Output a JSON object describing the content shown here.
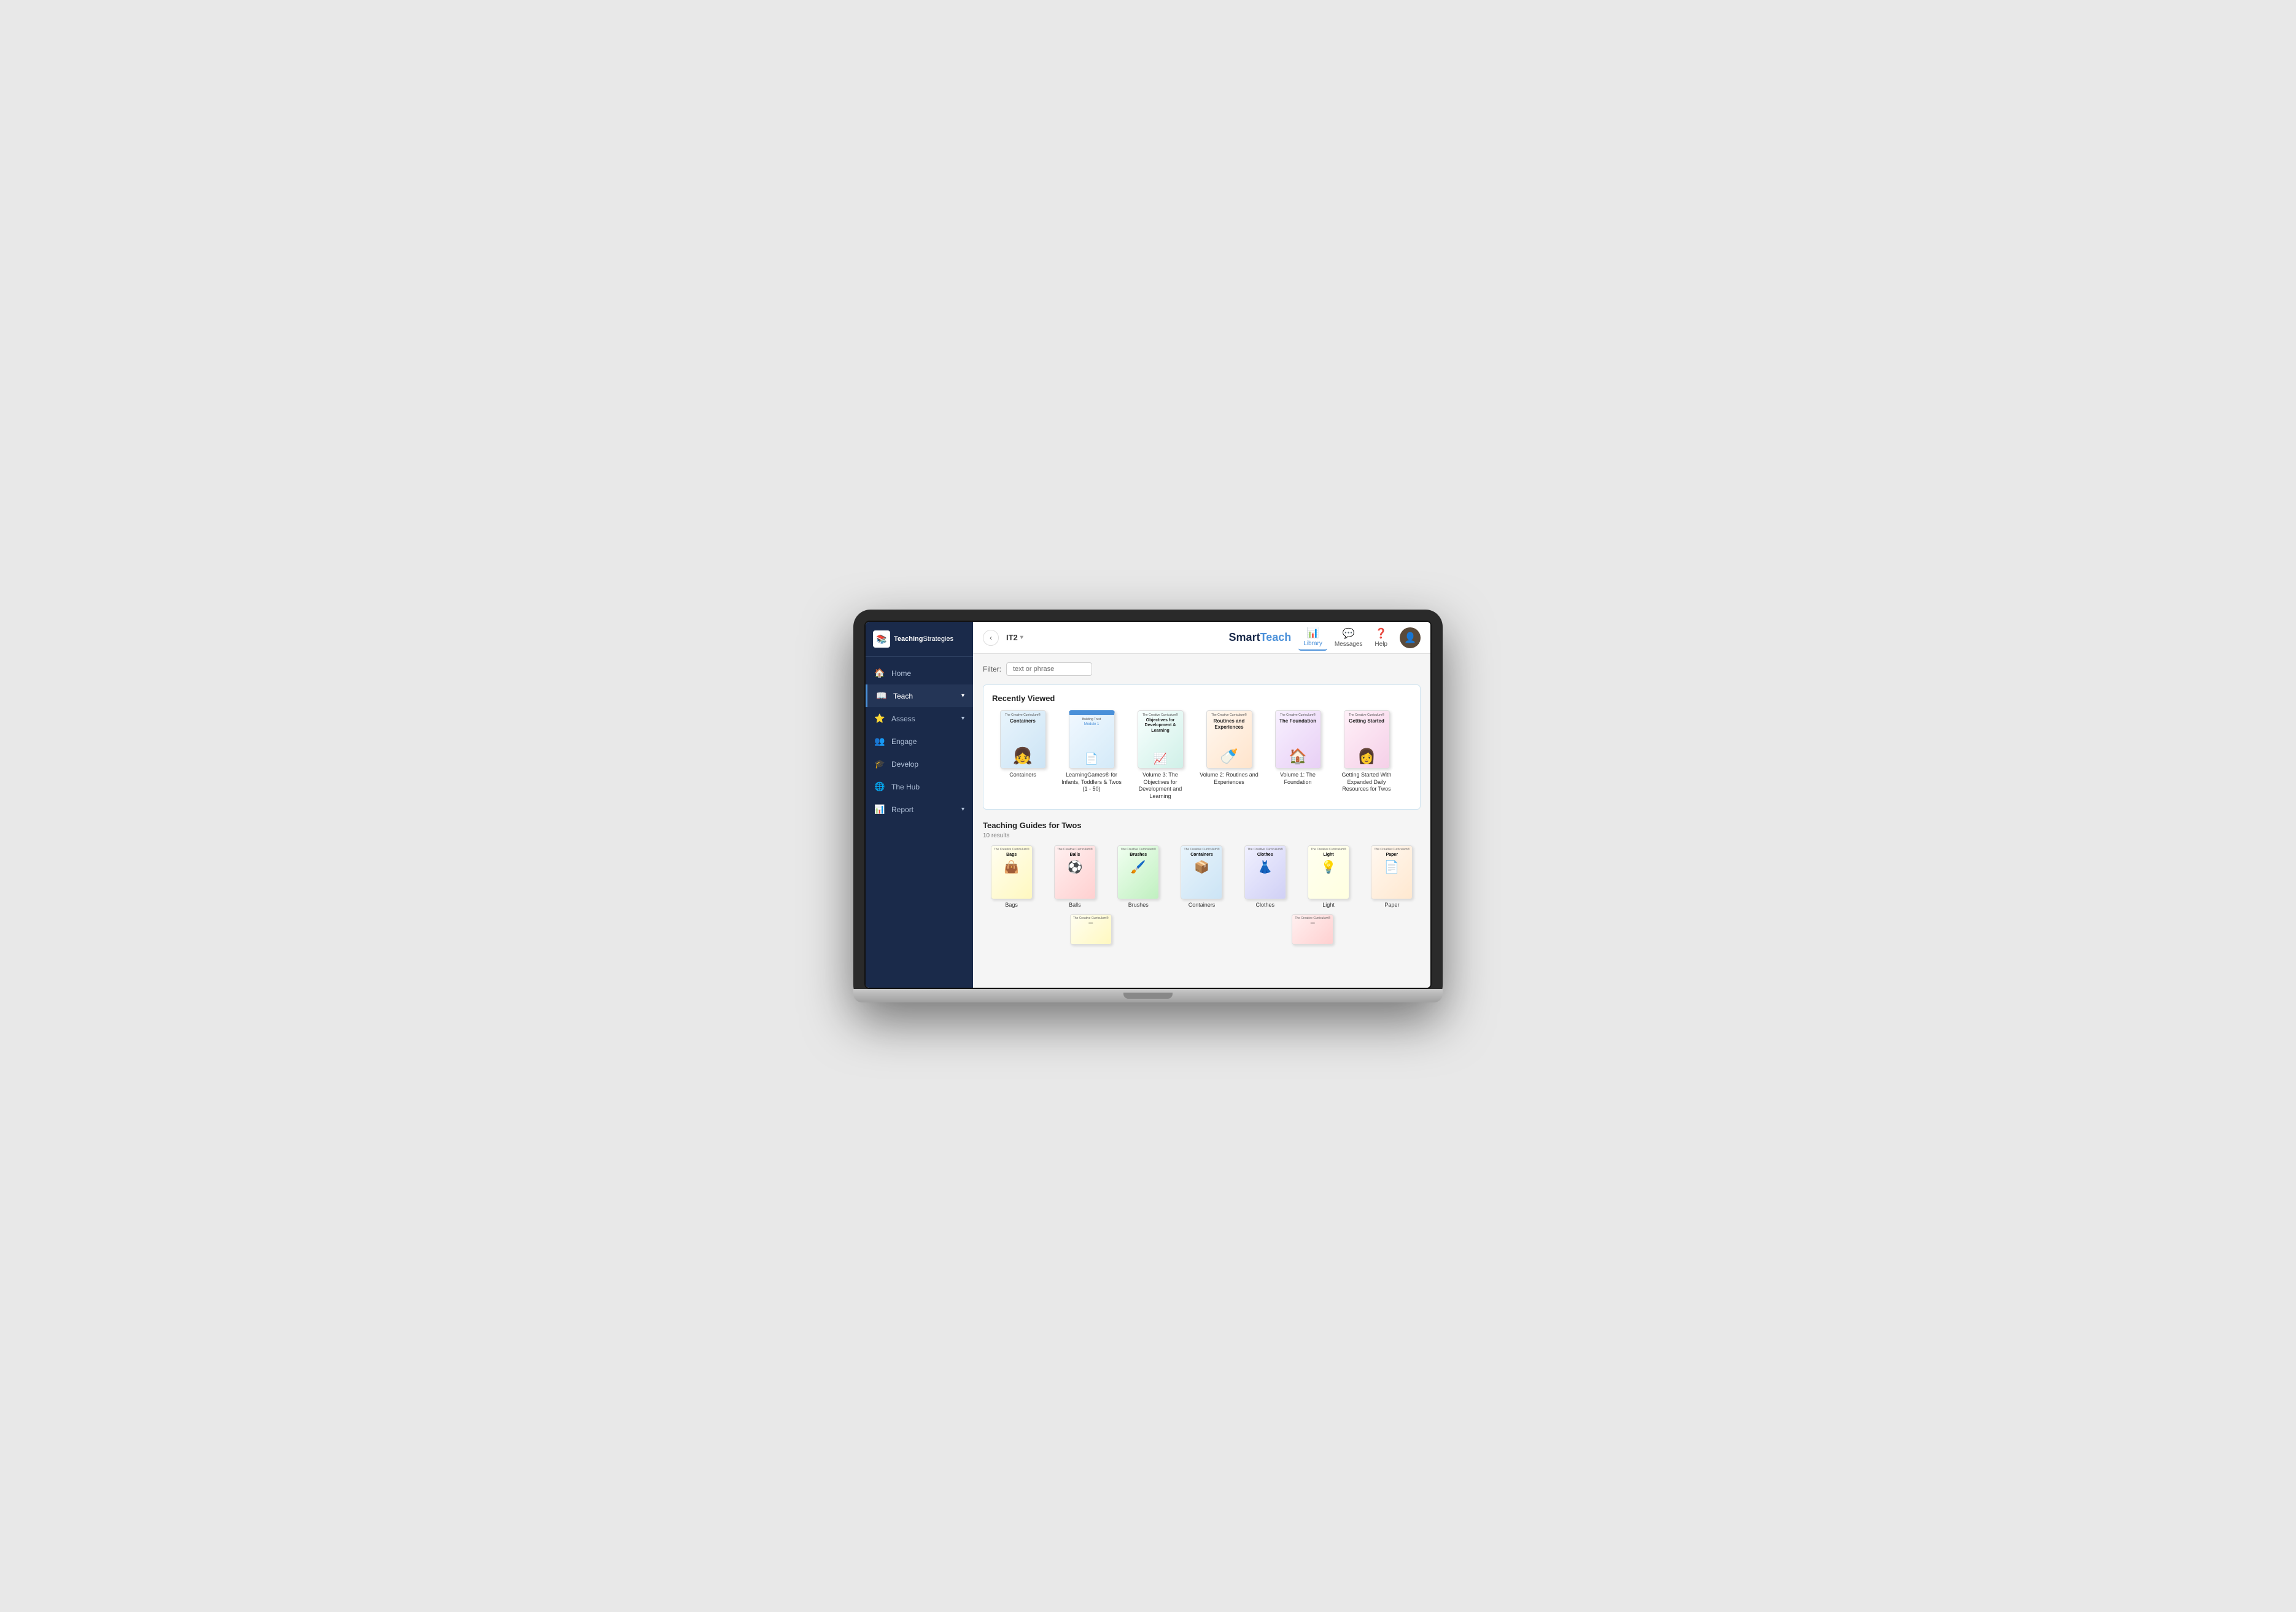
{
  "app": {
    "title": "TeachingStrategies",
    "logo_icon": "📚"
  },
  "topbar": {
    "back_label": "‹",
    "breadcrumb": "IT2",
    "brand_smart": "Smart",
    "brand_teach": "Teach",
    "library_label": "Library",
    "messages_label": "Messages",
    "help_label": "Help"
  },
  "sidebar": {
    "items": [
      {
        "label": "Home",
        "icon": "🏠",
        "active": false
      },
      {
        "label": "Teach",
        "icon": "📖",
        "active": true,
        "has_arrow": true
      },
      {
        "label": "Assess",
        "icon": "⭐",
        "active": false,
        "has_arrow": true
      },
      {
        "label": "Engage",
        "icon": "👥",
        "active": false
      },
      {
        "label": "Develop",
        "icon": "🎓",
        "active": false
      },
      {
        "label": "The Hub",
        "icon": "🌐",
        "active": false
      },
      {
        "label": "Report",
        "icon": "📊",
        "active": false,
        "has_arrow": true
      }
    ]
  },
  "filter": {
    "label": "Filter:",
    "placeholder": "text or phrase"
  },
  "recently_viewed": {
    "title": "Recently Viewed",
    "books": [
      {
        "label": "Containers",
        "color_class": "cover-containers",
        "title": "Containers",
        "has_person": true
      },
      {
        "label": "LearningGames® for Infants, Toddlers & Twos (1 - 50)",
        "color_class": "cover-learning",
        "title": "Building Trust",
        "has_person": false
      },
      {
        "label": "Volume 3: The Objectives for Development and Learning",
        "color_class": "cover-volume3",
        "title": "Objectives for Development & Learning",
        "has_person": false
      },
      {
        "label": "Volume 2: Routines and Experiences",
        "color_class": "cover-volume2",
        "title": "Routines and Experiences",
        "has_person": true
      },
      {
        "label": "Volume 1: The Foundation",
        "color_class": "cover-volume1",
        "title": "The Foundation",
        "has_person": true
      },
      {
        "label": "Getting Started With Expanded Daily Resources for Twos",
        "color_class": "cover-getting",
        "title": "Getting Started",
        "has_person": true
      }
    ]
  },
  "teaching_guides": {
    "title": "Teaching Guides for Twos",
    "results_count": "10 results",
    "guides": [
      {
        "label": "Bags",
        "color_class": "cover-bags"
      },
      {
        "label": "Balls",
        "color_class": "cover-balls"
      },
      {
        "label": "Brushes",
        "color_class": "cover-brushes"
      },
      {
        "label": "Containers",
        "color_class": "cover-cont2"
      },
      {
        "label": "Clothes",
        "color_class": "cover-clothes"
      },
      {
        "label": "Light",
        "color_class": "cover-light"
      },
      {
        "label": "Paper",
        "color_class": "cover-paper"
      }
    ],
    "bottom_guides": [
      {
        "label": "",
        "color_class": "cover-bags"
      },
      {
        "label": "",
        "color_class": "cover-balls"
      }
    ]
  }
}
